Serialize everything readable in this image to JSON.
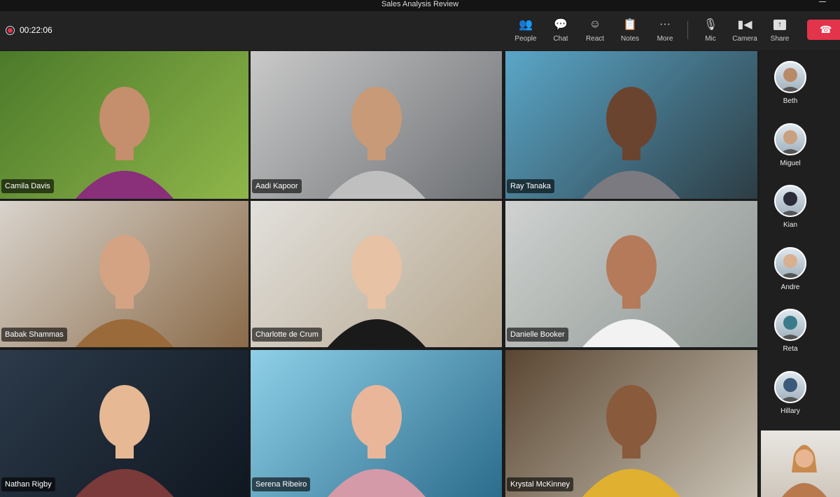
{
  "window": {
    "title": "Sales Analysis Review"
  },
  "recording": {
    "elapsed": "00:22:06",
    "color": "#e8334a"
  },
  "toolbar": [
    {
      "label": "People",
      "icon": "people-icon"
    },
    {
      "label": "Chat",
      "icon": "chat-icon"
    },
    {
      "label": "React",
      "icon": "react-icon"
    },
    {
      "label": "Notes",
      "icon": "notes-icon"
    },
    {
      "label": "More",
      "icon": "more-icon"
    },
    {
      "label": "Mic",
      "icon": "mic-icon"
    },
    {
      "label": "Camera",
      "icon": "camera-icon"
    },
    {
      "label": "Share",
      "icon": "share-icon"
    }
  ],
  "hangup": {
    "icon": "phone-hangup-icon",
    "color": "#e3344b"
  },
  "participants": [
    {
      "name": "Camila Davis"
    },
    {
      "name": "Aadi Kapoor"
    },
    {
      "name": "Ray Tanaka"
    },
    {
      "name": "Babak Shammas"
    },
    {
      "name": "Charlotte de Crum"
    },
    {
      "name": "Danielle Booker"
    },
    {
      "name": "Nathan Rigby"
    },
    {
      "name": "Serena Ribeiro"
    },
    {
      "name": "Krystal McKinney"
    }
  ],
  "sidebar": [
    {
      "name": "Beth"
    },
    {
      "name": "Miguel"
    },
    {
      "name": "Kian"
    },
    {
      "name": "Andre"
    },
    {
      "name": "Reta"
    },
    {
      "name": "Hillary"
    }
  ]
}
